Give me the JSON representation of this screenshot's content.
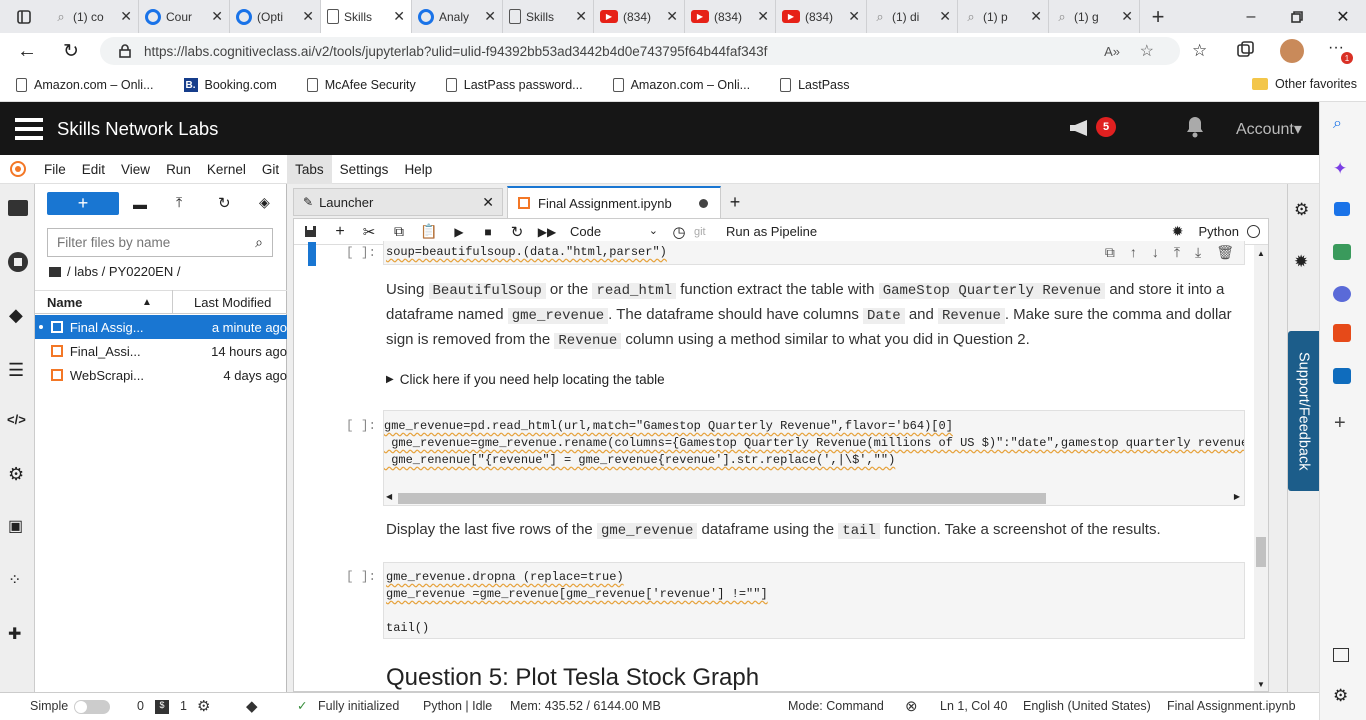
{
  "browser": {
    "tabs": [
      {
        "label": "(1) co",
        "fav": "srch"
      },
      {
        "label": "Cour",
        "fav": "c"
      },
      {
        "label": "(Opti",
        "fav": "c"
      },
      {
        "label": "Skills",
        "fav": "doc",
        "active": true
      },
      {
        "label": "Analy",
        "fav": "c"
      },
      {
        "label": "Skills",
        "fav": "doc"
      },
      {
        "label": "(834)",
        "fav": "yt"
      },
      {
        "label": "(834)",
        "fav": "yt"
      },
      {
        "label": "(834)",
        "fav": "yt"
      },
      {
        "label": "(1) di",
        "fav": "srch"
      },
      {
        "label": "(1) p",
        "fav": "srch"
      },
      {
        "label": "(1) g",
        "fav": "srch"
      }
    ],
    "url": "https://labs.cognitiveclass.ai/v2/tools/jupyterlab?ulid=ulid-f94392bb53ad3442b4d0e743795f64b44faf343f",
    "bookmarks": [
      "Amazon.com – Onli...",
      "Booking.com",
      "McAfee Security",
      "LastPass password...",
      "Amazon.com – Onli...",
      "LastPass"
    ],
    "other_favorites": "Other favorites",
    "notif_count": "1"
  },
  "app": {
    "title": "Skills Network Labs",
    "badge": "5",
    "account": "Account"
  },
  "menu": [
    "File",
    "Edit",
    "View",
    "Run",
    "Kernel",
    "Git",
    "Tabs",
    "Settings",
    "Help"
  ],
  "filebrowser": {
    "filter_placeholder": "Filter files by name",
    "path": "/ labs / PY0220EN /",
    "col_name": "Name",
    "col_modified": "Last Modified",
    "files": [
      {
        "name": "Final Assig...",
        "modified": "a minute ago",
        "selected": true
      },
      {
        "name": "Final_Assi...",
        "modified": "14 hours ago"
      },
      {
        "name": "WebScrapi...",
        "modified": "4 days ago"
      }
    ]
  },
  "doc_tabs": [
    {
      "label": "Launcher"
    },
    {
      "label": "Final Assignment.ipynb"
    }
  ],
  "nb_toolbar": {
    "cell_type": "Code",
    "git": "git",
    "pipeline": "Run as Pipeline",
    "kernel": "Python"
  },
  "cells": {
    "c1_prompt": "[ ]:",
    "c1_code": "soup=beautifulsoup.(data.\"html,parser\")",
    "md1_a": "Using",
    "md1_b": "BeautifulSoup",
    "md1_c": "or the",
    "md1_d": "read_html",
    "md1_e": "function extract the table with",
    "md1_f": "GameStop Quarterly Revenue",
    "md1_g": "and store it into a dataframe named",
    "md1_h": "gme_revenue",
    "md1_i": ". The dataframe should have columns",
    "md1_j": "Date",
    "md1_k": "and",
    "md1_l": "Revenue",
    "md1_m": ". Make sure the comma and dollar sign is removed from the",
    "md1_n": "Revenue",
    "md1_o": "column using a method similar to what you did in Question 2.",
    "details": "Click here if you need help locating the table",
    "c2_prompt": "[ ]:",
    "c2_line1": "gme_revenue=pd.read_html(url,match=\"Gamestop Quarterly Revenue\",flavor='b64)[0]",
    "c2_line2": " gme_revenue=gme_revenue.rename(columns={Gamestop Quarterly Revenue(millions of US $)\":\"date\",gamestop quarterly revenue(",
    "c2_line3": " gme_renenue[\"{revenue\"] = gme_revenue{revenue'].str.replace(',|\\$',\"\")",
    "md2_a": "Display the last five rows of the",
    "md2_b": "gme_revenue",
    "md2_c": "dataframe using the",
    "md2_d": "tail",
    "md2_e": "function. Take a screenshot of the results.",
    "c3_prompt": "[ ]:",
    "c3_line1": "gme_revenue.dropna (replace=true)",
    "c3_line2": "gme_revenue =gme_revenue[gme_revenue['revenue'] !=\"\"]",
    "c3_line4": "tail()",
    "heading": "Question 5: Plot Tesla Stock Graph"
  },
  "support": "Support/Feedback",
  "status": {
    "mode_label": "Simple",
    "n0": "0",
    "n1": "1",
    "init": "Fully initialized",
    "kernel": "Python | Idle",
    "mem": "Mem: 435.52 / 6144.00 MB",
    "cmd": "Mode: Command",
    "pos": "Ln 1, Col 40",
    "lang": "English (United States)",
    "file": "Final Assignment.ipynb"
  },
  "colors": {
    "accent": "#1976d2",
    "dark": "#161616",
    "red": "#e02020",
    "orange": "#f37726"
  }
}
